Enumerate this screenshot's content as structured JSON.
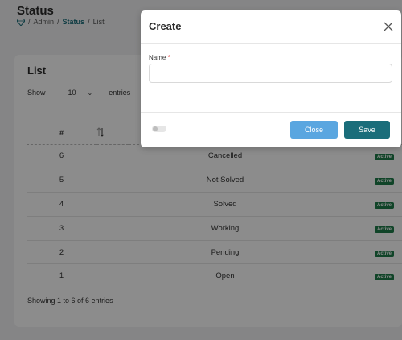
{
  "page": {
    "title": "Status",
    "breadcrumb": [
      "Admin",
      "Status",
      "List"
    ]
  },
  "card": {
    "title": "List",
    "show_label": "Show",
    "page_size": "10",
    "entries_label": "entries",
    "columns": {
      "number": "#"
    },
    "rows": [
      {
        "num": "6",
        "name": "Cancelled",
        "status": "Active"
      },
      {
        "num": "5",
        "name": "Not Solved",
        "status": "Active"
      },
      {
        "num": "4",
        "name": "Solved",
        "status": "Active"
      },
      {
        "num": "3",
        "name": "Working",
        "status": "Active"
      },
      {
        "num": "2",
        "name": "Pending",
        "status": "Active"
      },
      {
        "num": "1",
        "name": "Open",
        "status": "Active"
      }
    ],
    "footer": "Showing 1 to 6 of 6 entries"
  },
  "modal": {
    "title": "Create",
    "name_label": "Name",
    "required_mark": "*",
    "name_value": "",
    "close_label": "Close",
    "save_label": "Save"
  },
  "colors": {
    "primary": "#1a6d7a",
    "secondary": "#5aa6e0",
    "badge": "#1e7d4a"
  }
}
